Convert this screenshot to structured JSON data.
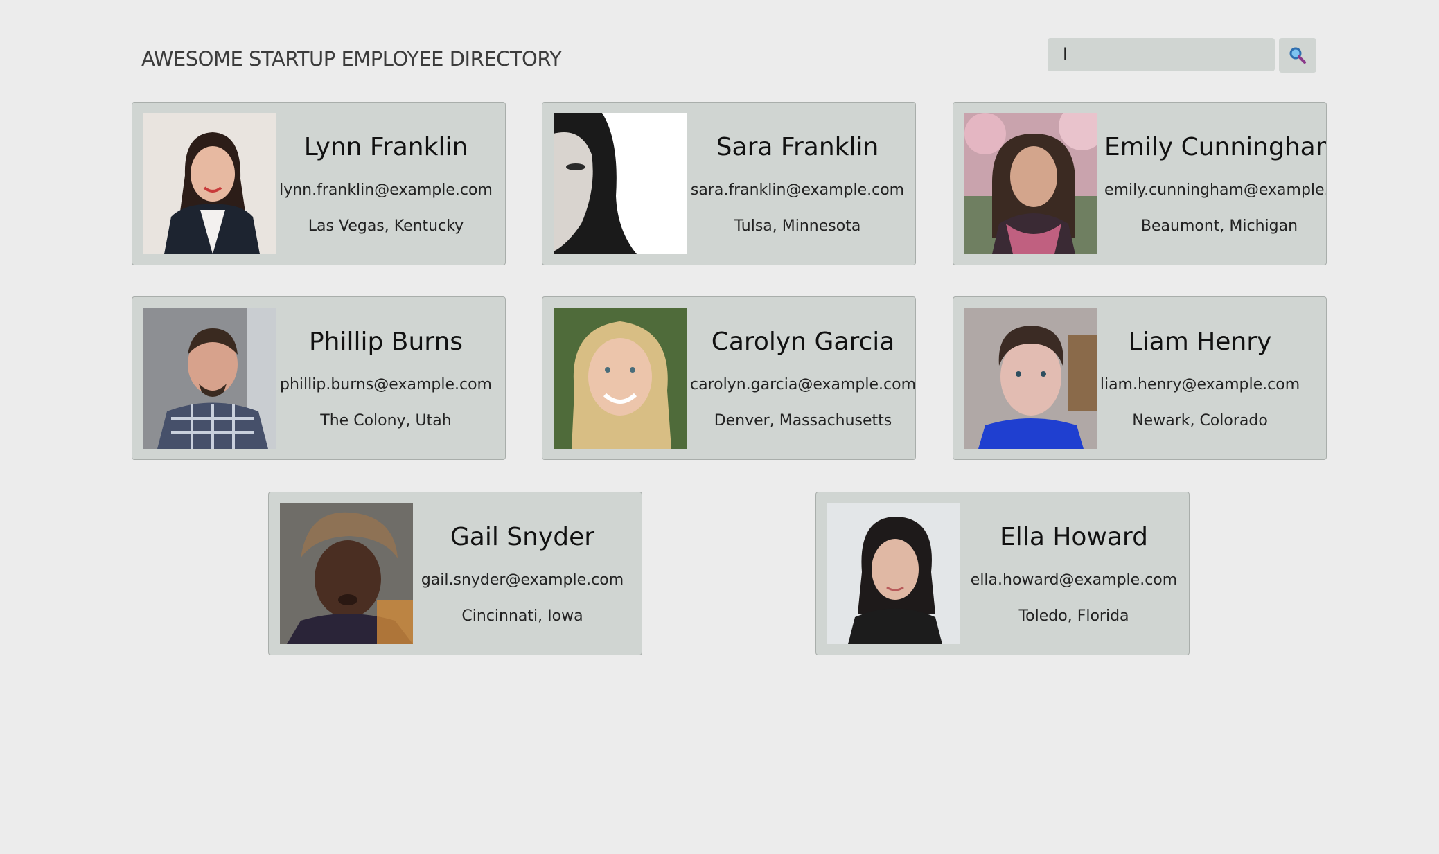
{
  "header": {
    "title": "AWESOME STARTUP EMPLOYEE DIRECTORY"
  },
  "search": {
    "value": "l",
    "icon": "search-icon",
    "accent": "#3a8fd8"
  },
  "employees": [
    {
      "name": "Lynn Franklin",
      "email": "lynn.franklin@example.com",
      "location": "Las Vegas, Kentucky"
    },
    {
      "name": "Sara Franklin",
      "email": "sara.franklin@example.com",
      "location": "Tulsa, Minnesota"
    },
    {
      "name": "Emily Cunningham",
      "email": "emily.cunningham@example.com",
      "location": "Beaumont, Michigan"
    },
    {
      "name": "Phillip Burns",
      "email": "phillip.burns@example.com",
      "location": "The Colony, Utah"
    },
    {
      "name": "Carolyn Garcia",
      "email": "carolyn.garcia@example.com",
      "location": "Denver, Massachusetts"
    },
    {
      "name": "Liam Henry",
      "email": "liam.henry@example.com",
      "location": "Newark, Colorado"
    },
    {
      "name": "Gail Snyder",
      "email": "gail.snyder@example.com",
      "location": "Cincinnati, Iowa"
    },
    {
      "name": "Ella Howard",
      "email": "ella.howard@example.com",
      "location": "Toledo, Florida"
    }
  ]
}
